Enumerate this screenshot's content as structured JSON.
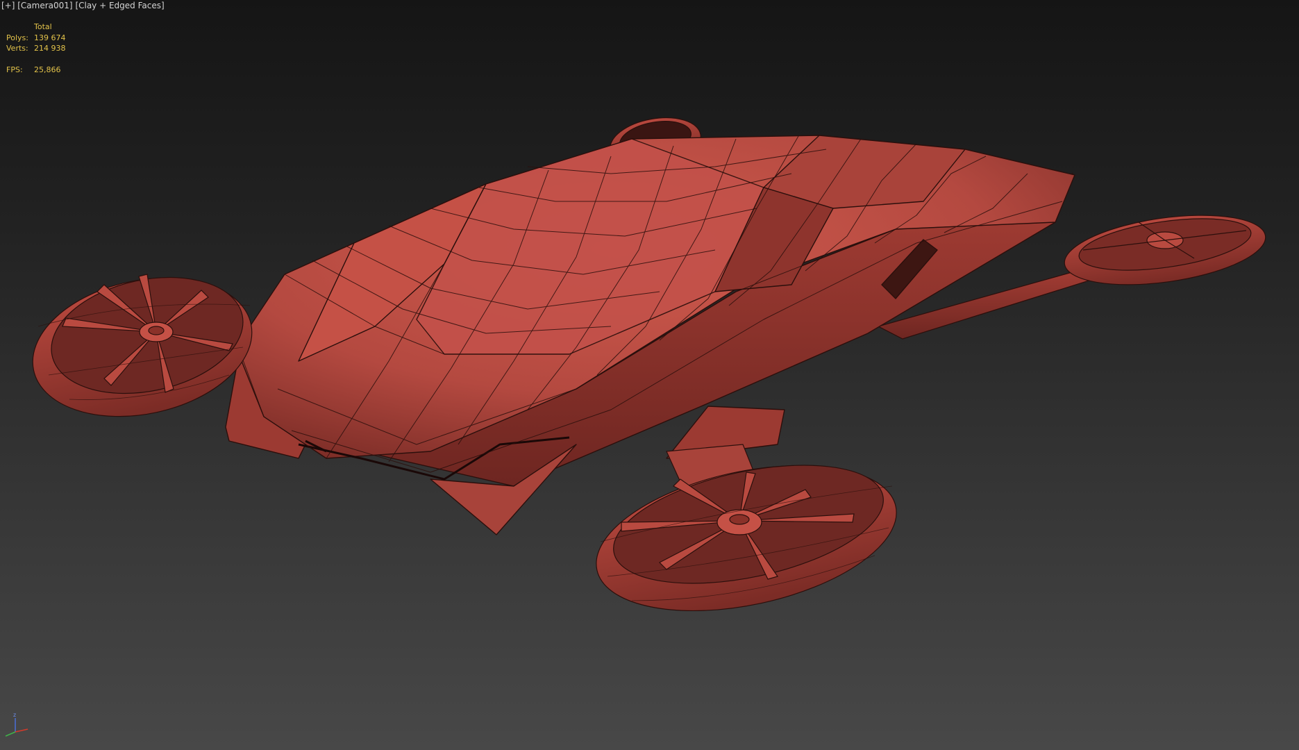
{
  "viewport": {
    "menu_label": "[+]",
    "camera_label": "[Camera001]",
    "shading_label": "[Clay + Edged Faces]"
  },
  "stats": {
    "header": "Total",
    "polys_label": "Polys:",
    "polys_value": "139 674",
    "verts_label": "Verts:",
    "verts_value": "214 938",
    "fps_label": "FPS:",
    "fps_value": "25,866"
  },
  "gizmo": {
    "z_label": "z"
  },
  "colors": {
    "clay": "#b94a40",
    "clay_dark": "#7e2e28",
    "wire": "#2b0f0c",
    "stats_text": "#e3c34a"
  }
}
